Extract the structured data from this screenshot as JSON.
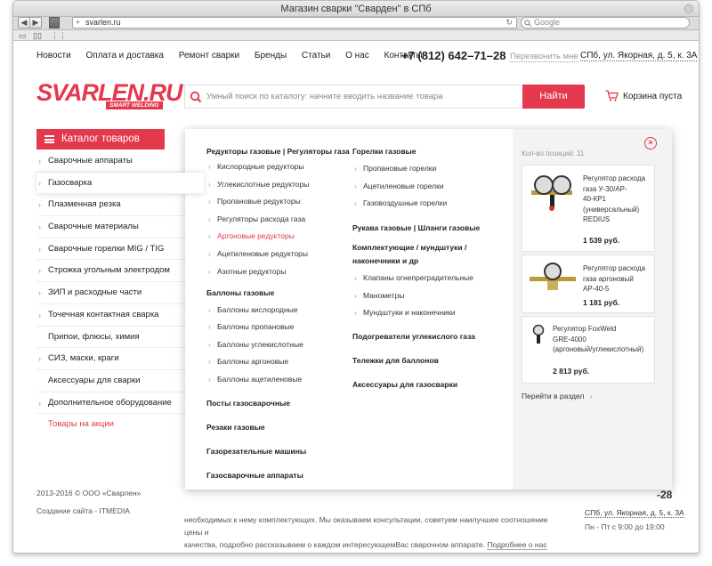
{
  "browser": {
    "window_title": "Магазин сварки \"Сварден\" в СПб",
    "url": "svarlen.ru",
    "search_placeholder": "Google",
    "back": "◀",
    "forward": "▶",
    "add_tab": "+",
    "reload": "↻"
  },
  "header": {
    "nav": [
      "Новости",
      "Оплата и доставка",
      "Ремонт сварки",
      "Бренды",
      "Статьи",
      "О нас",
      "Контакты"
    ],
    "phone": "+7 (812) 642–71–28",
    "callback": "Перезвонить мне",
    "address": "СПб, ул. Якорная, д. 5, к. 3А"
  },
  "logo": {
    "main": "SVARLEN.RU",
    "sub": "SMART WELDING"
  },
  "search": {
    "placeholder": "Умный поиск по каталогу: начните вводить название товара",
    "button": "Найти"
  },
  "cart": {
    "label": "Корзина пуста"
  },
  "catalog": {
    "button": "Каталог товаров",
    "items": [
      {
        "label": "Сварочные аппараты",
        "chev": "›"
      },
      {
        "label": "Газосварка",
        "chev": "›"
      },
      {
        "label": "Плазменная резка",
        "chev": "›"
      },
      {
        "label": "Сварочные материалы",
        "chev": "›"
      },
      {
        "label": "Сварочные горелки MIG / TIG",
        "chev": "›"
      },
      {
        "label": "Строжка угольным электродом",
        "chev": "›"
      },
      {
        "label": "ЗИП и расходные части",
        "chev": "›"
      },
      {
        "label": "Точечная контактная сварка",
        "chev": "›"
      },
      {
        "label": "Припои, флюсы, химия",
        "chev": ""
      },
      {
        "label": "СИЗ, маски, краги",
        "chev": "›"
      },
      {
        "label": "Аксессуары для сварки",
        "chev": ""
      },
      {
        "label": "Дополнительное оборудование",
        "chev": "›"
      },
      {
        "label": "Товары на акции",
        "chev": ""
      }
    ]
  },
  "mega": {
    "col1": {
      "group1_title": "Редукторы газовые | Регуляторы газа",
      "group1_links": [
        "Кислородные редукторы",
        "Углекислотные редукторы",
        "Пропановые редукторы",
        "Регуляторы расхода газа",
        "Аргоновые редукторы",
        "Ацетиленовые редукторы",
        "Азотные редукторы"
      ],
      "group2_title": "Баллоны газовые",
      "group2_links": [
        "Баллоны кислородные",
        "Баллоны пропановые",
        "Баллоны углекислотные",
        "Баллоны аргоновые",
        "Баллоны ацетиленовые"
      ],
      "title3": "Посты газосварочные",
      "title4": "Резаки газовые",
      "title5": "Газорезательные машины",
      "title6": "Газосварочные аппараты"
    },
    "col2": {
      "group1_title": "Горелки газовые",
      "group1_links": [
        "Пропановые горелки",
        "Ацетиленовые горелки",
        "Газовоздушные горелки"
      ],
      "title2": "Рукава газовые | Шланги газовые",
      "group3_title_line1": "Комплектующие / мундштуки /",
      "group3_title_line2": "наконечники и др",
      "group3_links": [
        "Клапаны огнепреградительные",
        "Манометры",
        "Мундштуки и наконечники"
      ],
      "title4": "Подогреватели углекислого газа",
      "title5": "Тележки для баллонов",
      "title6": "Аксессуары для газосварки"
    },
    "right": {
      "count": "Кол-во позиций: 11",
      "close": "×",
      "products": [
        {
          "name_lines": [
            "Регулятор расхода",
            "газа У-30/АР-",
            "40-КР1",
            "(универсальный)",
            "REDIUS"
          ],
          "price": "1 539 руб."
        },
        {
          "name_lines": [
            "Регулятор расхода",
            "газа аргоновый",
            "АР-40-5"
          ],
          "price": "1 181 руб."
        },
        {
          "name_lines": [
            "Регулятор FoxWeld",
            "GRE-4000",
            "(аргоновый/углекислотный)"
          ],
          "price": "2 813 руб."
        }
      ],
      "goto": "Перейти в раздел",
      "goto_chev": "›"
    }
  },
  "footer": {
    "copyright": "2013-2016 © ООО «Сварлен»",
    "created": "Создание сайта - ITMEDIA",
    "text_line1": "необходимых к нему комплектующих. Мы оказываем консультации, советуем наилучшее соотношение цены и",
    "text_line2": "качества, подробно рассказываем о каждом интересующемВас сварочном аппарате.",
    "more": "Подробнее о нас",
    "phone_tail": "-28",
    "address_tail": "СПб, ул. Якорная, д. 5, к. 3А",
    "hours": "Пн - Пт с 9:00 до 19:00"
  },
  "colors": {
    "accent": "#e4384c"
  }
}
